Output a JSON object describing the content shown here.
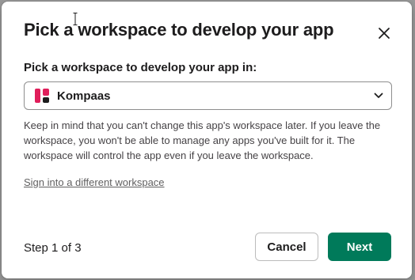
{
  "dialog": {
    "title": "Pick a workspace to develop your app",
    "close_icon": "close-icon"
  },
  "workspace_field": {
    "label": "Pick a workspace to develop your app in:",
    "selected_workspace": "Kompaas",
    "logo_colors": [
      "#e01e5a",
      "#1d1c1d"
    ]
  },
  "help_text": "Keep in mind that you can't change this app's workspace later. If you leave the workspace, you won't be able to manage any apps you've built for it. The workspace will control the app even if you leave the workspace.",
  "alt_link": "Sign into a different workspace",
  "footer": {
    "step_text": "Step 1 of 3",
    "cancel_label": "Cancel",
    "next_label": "Next",
    "next_color": "#007a5a"
  }
}
